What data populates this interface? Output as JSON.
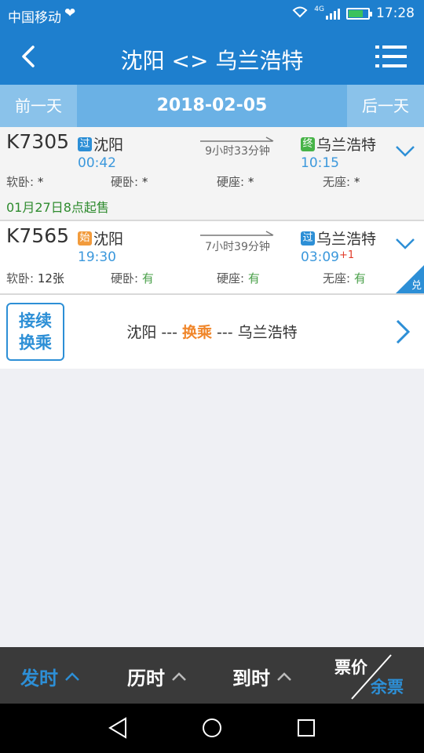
{
  "status_bar": {
    "carrier": "中国移动",
    "time": "17:28",
    "network": "4G"
  },
  "header": {
    "title": "沈阳 <> 乌兰浩特"
  },
  "date_bar": {
    "prev_label": "前一天",
    "date": "2018-02-05",
    "next_label": "后一天"
  },
  "trains": [
    {
      "number": "K7305",
      "from_badge": "过",
      "from": "沈阳",
      "depart": "00:42",
      "duration": "9小时33分钟",
      "to_badge": "终",
      "to": "乌兰浩特",
      "arrive": "10:15",
      "arrive_plus": "",
      "seats": [
        {
          "label": "软卧:",
          "value": "*"
        },
        {
          "label": "硬卧:",
          "value": "*"
        },
        {
          "label": "硬座:",
          "value": "*"
        },
        {
          "label": "无座:",
          "value": "*"
        }
      ],
      "sale_note": "01月27日8点起售"
    },
    {
      "number": "K7565",
      "from_badge": "始",
      "from": "沈阳",
      "depart": "19:30",
      "duration": "7小时39分钟",
      "to_badge": "过",
      "to": "乌兰浩特",
      "arrive": "03:09",
      "arrive_plus": "+1",
      "seats": [
        {
          "label": "软卧:",
          "value": "12张"
        },
        {
          "label": "硬卧:",
          "value": "有"
        },
        {
          "label": "硬座:",
          "value": "有"
        },
        {
          "label": "无座:",
          "value": "有"
        }
      ],
      "corner_tag": "兑"
    }
  ],
  "transfer": {
    "box_line1": "接续",
    "box_line2": "换乘",
    "from": "沈阳",
    "sep1": " --- ",
    "middle": "换乘",
    "sep2": " --- ",
    "to": "乌兰浩特"
  },
  "sort_bar": {
    "depart_label": "发时",
    "duration_label": "历时",
    "arrive_label": "到时",
    "price_label": "票价",
    "remain_label": "余票"
  },
  "colors": {
    "primary": "#1e7fce",
    "accent": "#2d8fd6",
    "orange": "#f0862a",
    "green": "#4aa04a",
    "dark_bar": "#3a3a3a"
  }
}
